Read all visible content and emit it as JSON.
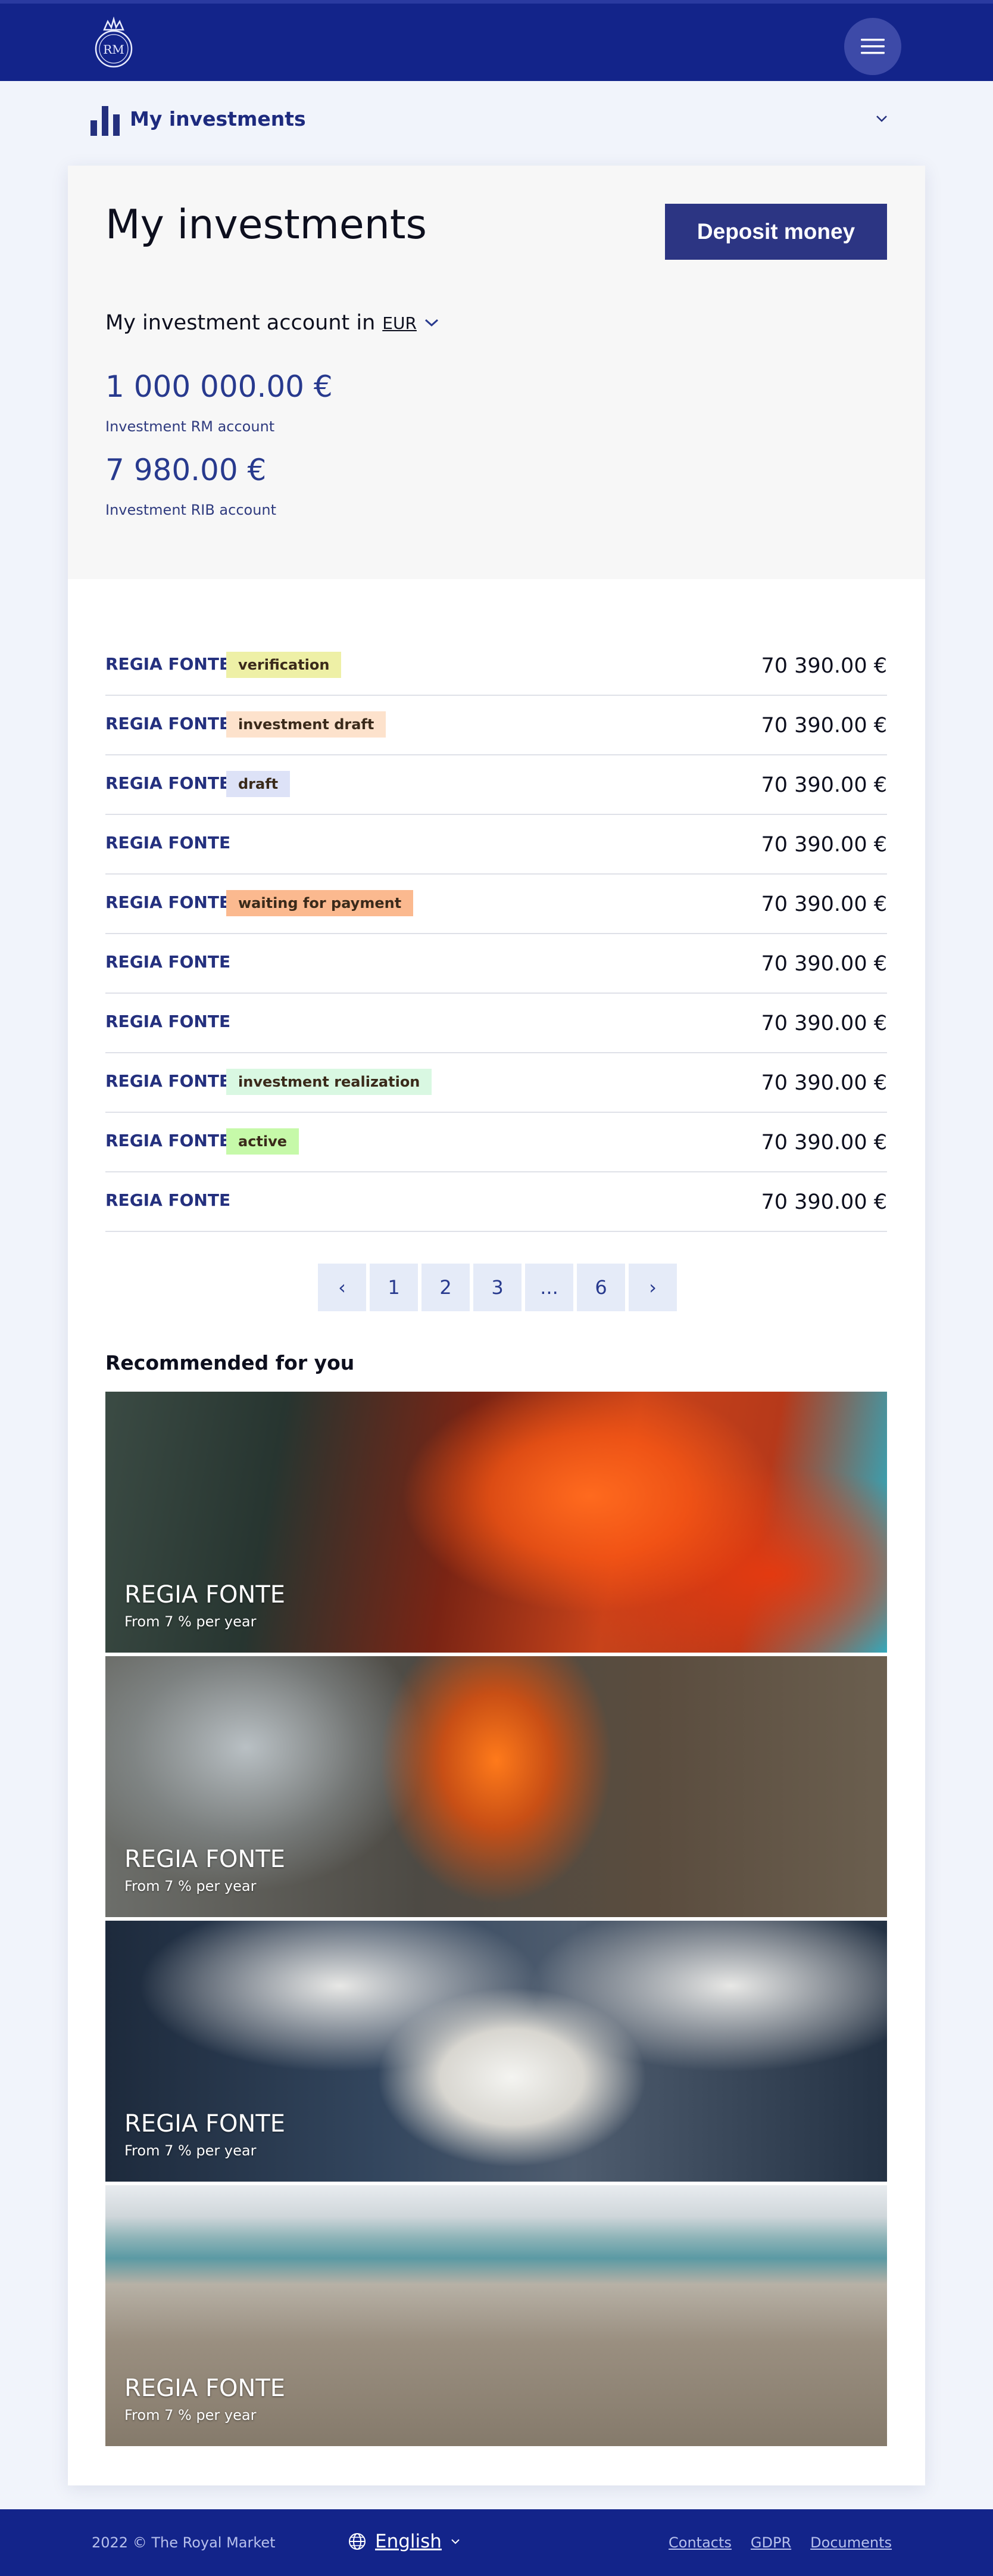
{
  "header": {
    "logo_text": "RM",
    "menu_icon": "hamburger-icon"
  },
  "subnav": {
    "icon": "bar-chart-icon",
    "title": "My investments",
    "toggle_icon": "chevron-down-icon"
  },
  "main": {
    "title": "My investments",
    "deposit_label": "Deposit money",
    "account_prefix": "My investment account in",
    "currency": "EUR",
    "accounts": [
      {
        "amount": "1 000 000.00 €",
        "label": "Investment RM account"
      },
      {
        "amount": "7 980.00 €",
        "label": "Investment RIB account"
      }
    ]
  },
  "investments": [
    {
      "name": "REGIA FONTE",
      "status": "verification",
      "status_color": "#eef0a6",
      "value": "70 390.00 €"
    },
    {
      "name": "REGIA FONTE",
      "status": "investment draft",
      "status_color": "#fde2cc",
      "value": "70 390.00 €"
    },
    {
      "name": "REGIA FONTE",
      "status": "draft",
      "status_color": "#dde2f7",
      "value": "70 390.00 €"
    },
    {
      "name": "REGIA FONTE",
      "status": "",
      "status_color": "",
      "value": "70 390.00 €"
    },
    {
      "name": "REGIA FONTE",
      "status": "waiting for payment",
      "status_color": "#fbb98f",
      "value": "70 390.00 €"
    },
    {
      "name": "REGIA FONTE",
      "status": "",
      "status_color": "",
      "value": "70 390.00 €"
    },
    {
      "name": "REGIA FONTE",
      "status": "",
      "status_color": "",
      "value": "70 390.00 €"
    },
    {
      "name": "REGIA FONTE",
      "status": "investment realization",
      "status_color": "#d9f8e2",
      "value": "70 390.00 €"
    },
    {
      "name": "REGIA FONTE",
      "status": "active",
      "status_color": "#c6f9a9",
      "value": "70 390.00 €"
    },
    {
      "name": "REGIA FONTE",
      "status": "",
      "status_color": "",
      "value": "70 390.00 €"
    }
  ],
  "pagination": [
    "‹",
    "1",
    "2",
    "3",
    "...",
    "6",
    "›"
  ],
  "recommended": {
    "title": "Recommended for you",
    "items": [
      {
        "name": "REGIA FONTE",
        "rate": "From 7 % per year",
        "image": "volcano-eruption-clouds"
      },
      {
        "name": "REGIA FONTE",
        "rate": "From 7 % per year",
        "image": "lava-flow-forest"
      },
      {
        "name": "REGIA FONTE",
        "rate": "From 7 % per year",
        "image": "snowy-owl-flying"
      },
      {
        "name": "REGIA FONTE",
        "rate": "From 7 % per year",
        "image": "stormy-beach"
      }
    ]
  },
  "footer": {
    "copyright": "2022 © The Royal Market",
    "language": "English",
    "links": [
      "Contacts",
      "GDPR",
      "Documents"
    ]
  }
}
